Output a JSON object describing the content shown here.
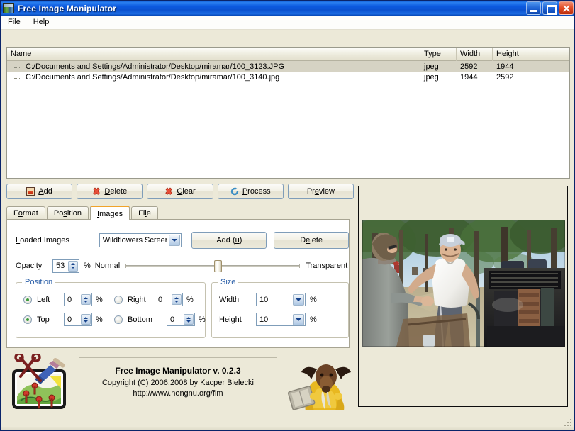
{
  "window": {
    "title": "Free Image Manipulator",
    "icon": "app-image-icon",
    "minimize_label": "Minimize",
    "maximize_label": "Maximize",
    "close_label": "Close"
  },
  "menu": {
    "items": [
      {
        "label": "File"
      },
      {
        "label": "Help"
      }
    ]
  },
  "file_list": {
    "columns": [
      {
        "key": "name",
        "label": "Name"
      },
      {
        "key": "type",
        "label": "Type"
      },
      {
        "key": "width",
        "label": "Width"
      },
      {
        "key": "height",
        "label": "Height"
      }
    ],
    "rows": [
      {
        "name": "C:/Documents and Settings/Administrator/Desktop/miramar/100_3123.JPG",
        "type": "jpeg",
        "width": "2592",
        "height": "1944",
        "selected": true
      },
      {
        "name": "C:/Documents and Settings/Administrator/Desktop/miramar/100_3140.jpg",
        "type": "jpeg",
        "width": "1944",
        "height": "2592",
        "selected": false
      }
    ]
  },
  "actions": {
    "add": {
      "label": "Add",
      "mnemonic": "A",
      "icon": "add-image-icon"
    },
    "delete": {
      "label": "Delete",
      "mnemonic": "D",
      "icon": "delete-red-icon"
    },
    "clear": {
      "label": "Clear",
      "mnemonic": "C",
      "icon": "clear-red-icon"
    },
    "process": {
      "label": "Process",
      "mnemonic": "P",
      "icon": "process-refresh-icon"
    },
    "preview": {
      "label": "Preview",
      "mnemonic": "e",
      "icon": ""
    }
  },
  "tabs": [
    {
      "label": "Format",
      "mnemonic": "o",
      "active": false
    },
    {
      "label": "Position",
      "mnemonic": "s",
      "active": false
    },
    {
      "label": "Images",
      "mnemonic": "I",
      "active": true
    },
    {
      "label": "File",
      "mnemonic": "l",
      "active": false
    }
  ],
  "images_tab": {
    "loaded_images": {
      "label": "Loaded Images",
      "label_mnemonic": "L",
      "selected_value": "Wildflowers Screer",
      "add_button": "Add (u)",
      "delete_button": "Delete",
      "delete_mnemonic": "e"
    },
    "opacity": {
      "label": "Opacity",
      "label_mnemonic": "O",
      "value": "53",
      "unit": "%",
      "slider_min_label": "Normal",
      "slider_max_label": "Transparent",
      "slider_percent": 53
    },
    "position_group": {
      "title": "Position",
      "left": {
        "label": "Left",
        "mnemonic": "t",
        "selected": true,
        "value": "0",
        "unit": "%"
      },
      "right": {
        "label": "Right",
        "mnemonic": "R",
        "selected": false,
        "value": "0",
        "unit": "%"
      },
      "top": {
        "label": "Top",
        "mnemonic": "T",
        "selected": true,
        "value": "0",
        "unit": "%"
      },
      "bottom": {
        "label": "Bottom",
        "mnemonic": "B",
        "selected": false,
        "value": "0",
        "unit": "%"
      }
    },
    "size_group": {
      "title": "Size",
      "width": {
        "label": "Width",
        "mnemonic": "W",
        "value": "10",
        "unit": "%"
      },
      "height": {
        "label": "Height",
        "mnemonic": "H",
        "value": "10",
        "unit": "%"
      }
    }
  },
  "preview": {
    "panel_name": "preview-panel",
    "photo_description": "Outdoor barbecue scene: man in white t-shirt and grey cap shaking hands with a woman in a grey jacket, pine forest and grill in background"
  },
  "about": {
    "line1": "Free Image Manipulator v. 0.2.3",
    "line2": "Copyright (C) 2006,2008 by Kacper Bielecki",
    "line3": "http://www.nongnu.org/fim",
    "logo_icon": "app-logo-scissors-brush-icon",
    "mascot_icon": "gnu-mascot-icon"
  },
  "colors": {
    "window_background": "#ece9d8",
    "title_bar": "#0b51cf",
    "active_tab_accent": "#f0a32a",
    "group_title": "#2b5fa8",
    "radio_on": "#3e9c3e",
    "list_selection": "#d6d3c4"
  }
}
